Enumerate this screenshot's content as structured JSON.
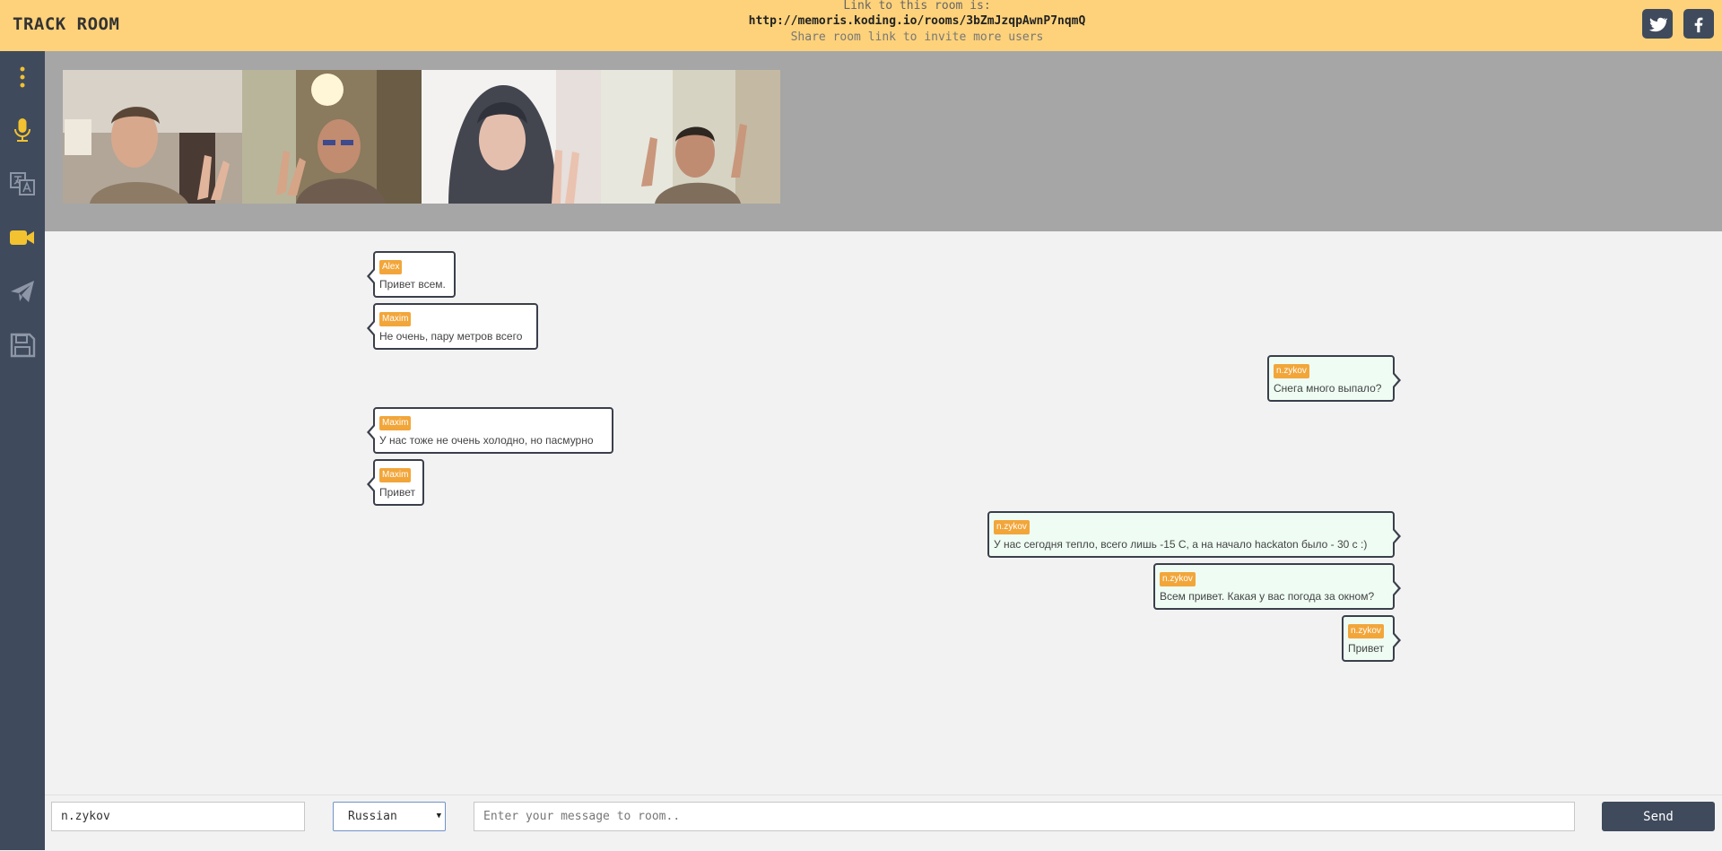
{
  "app": {
    "title": "TRACK ROOM"
  },
  "header": {
    "link_label": "Link to this room is:",
    "link_url": "http://memoris.koding.io/rooms/3bZmJzqpAwnP7nqmQ",
    "share_text": "Share room link to invite more users",
    "social": [
      {
        "icon": "twitter-icon"
      },
      {
        "icon": "facebook-icon"
      }
    ]
  },
  "sidebar": {
    "items": [
      {
        "icon": "more-icon",
        "active": true
      },
      {
        "icon": "microphone-icon",
        "active": true
      },
      {
        "icon": "translate-icon",
        "active": false
      },
      {
        "icon": "video-camera-icon",
        "active": true
      },
      {
        "icon": "send-icon",
        "active": false
      },
      {
        "icon": "save-icon",
        "active": false
      }
    ]
  },
  "videos": [
    {
      "participant": "video-1"
    },
    {
      "participant": "video-2"
    },
    {
      "participant": "video-3"
    },
    {
      "participant": "video-4"
    }
  ],
  "messages": [
    {
      "author": "Alex",
      "text": "Привет всем.",
      "side": "left"
    },
    {
      "author": "Maxim",
      "text": "Не очень, пару метров всего",
      "side": "left"
    },
    {
      "author": "n.zykov",
      "text": "Снега много выпало?",
      "side": "right"
    },
    {
      "author": "Maxim",
      "text": "У нас тоже не очень холодно, но пасмурно",
      "side": "left"
    },
    {
      "author": "Maxim",
      "text": "Привет",
      "side": "left"
    },
    {
      "author": "n.zykov",
      "text": "У нас сегодня тепло, всего лишь -15 С, а на начало hackaton было - 30 с :)",
      "side": "right"
    },
    {
      "author": "n.zykov",
      "text": "Всем привет. Какая у вас погода за окном?",
      "side": "right"
    },
    {
      "author": "n.zykov",
      "text": "Привет",
      "side": "right"
    }
  ],
  "footer": {
    "username": "n.zykov",
    "language": "Russian",
    "message_placeholder": "Enter your message to room..",
    "send_label": "Send"
  },
  "colors": {
    "header_bg": "#fed27a",
    "sidebar_bg": "#3f4a5c",
    "accent": "#f2c230",
    "author_badge": "#f2a63a",
    "own_message_bg": "#eefcf3"
  }
}
